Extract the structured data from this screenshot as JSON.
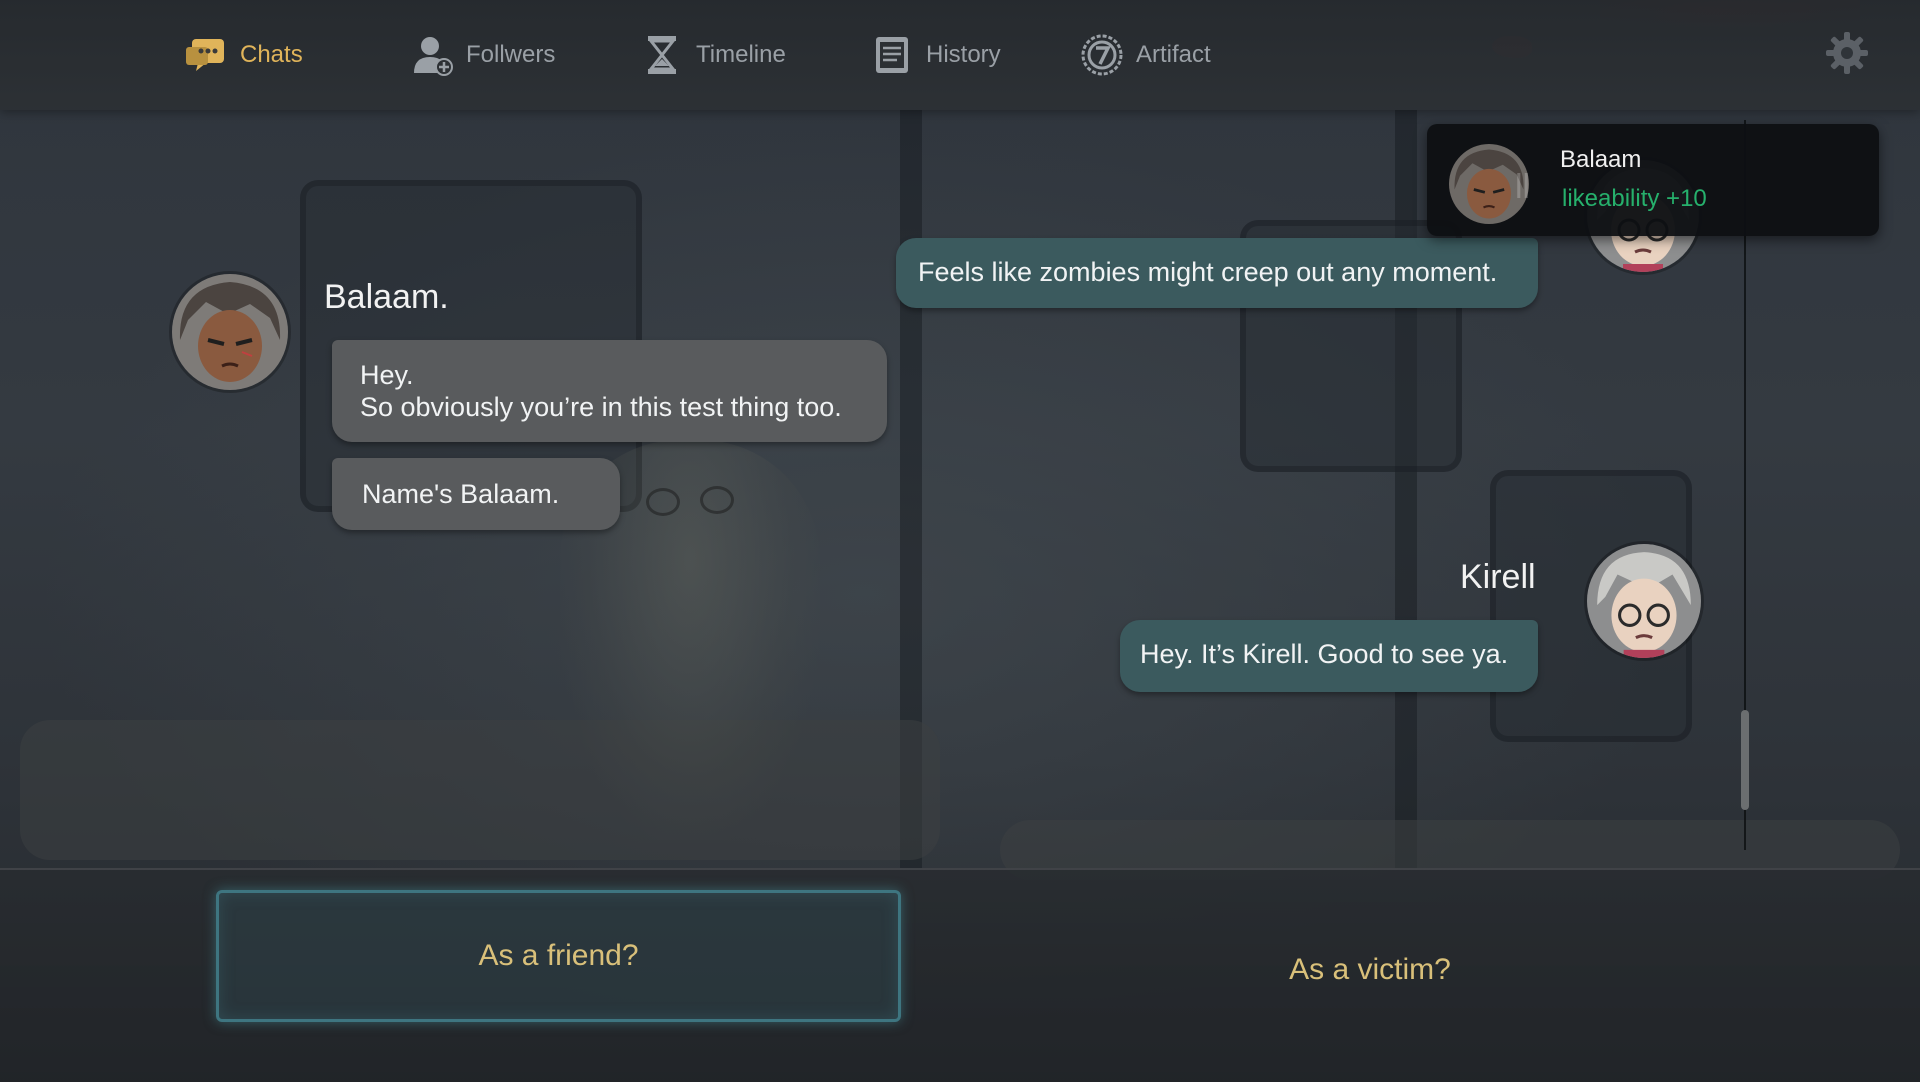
{
  "nav": {
    "tabs": [
      {
        "label": "Chats",
        "icon": "chat-icon",
        "active": true
      },
      {
        "label": "Follwers",
        "icon": "followers-icon",
        "active": false
      },
      {
        "label": "Timeline",
        "icon": "hourglass-icon",
        "active": false
      },
      {
        "label": "History",
        "icon": "book-icon",
        "active": false
      },
      {
        "label": "Artifact",
        "icon": "artifact-icon",
        "active": false
      }
    ],
    "settings_icon": "gear-icon",
    "active_color": "#e0b45a",
    "inactive_color": "#9aa0a6"
  },
  "notification": {
    "name": "Balaam",
    "stat_label": "likeability",
    "stat_value": "+10",
    "stat_color": "#26b06c"
  },
  "chat": {
    "messages": [
      {
        "sender": "Kirell",
        "side": "right",
        "text": "Feels like zombies might creep out any moment."
      },
      {
        "sender": "Balaam.",
        "side": "left",
        "lines": [
          "Hey.",
          "So obviously you’re in this test thing too."
        ]
      },
      {
        "sender": "Balaam.",
        "side": "left",
        "text": "Name's Balaam."
      },
      {
        "sender": "Kirell",
        "side": "right",
        "text": "Hey. It’s Kirell. Good to see ya."
      }
    ],
    "left_speaker": "Balaam.",
    "right_speaker": "Kirell",
    "partial_name_fragment": "ll"
  },
  "choices": [
    {
      "label": "As a friend?",
      "selected": true
    },
    {
      "label": "As a victim?",
      "selected": false
    }
  ],
  "colors": {
    "left_bubble": "#595b5d",
    "right_bubble": "#3b5a5e",
    "choice_text": "#d9c07a"
  }
}
